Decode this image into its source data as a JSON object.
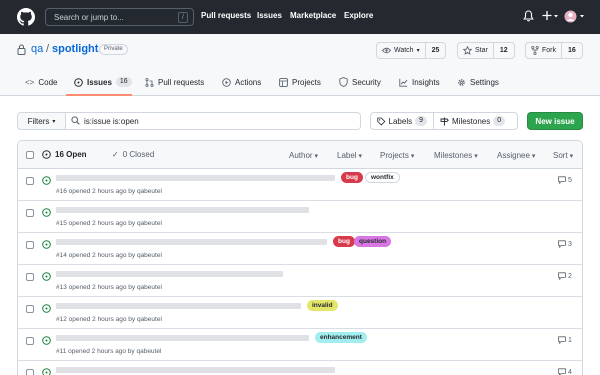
{
  "header": {
    "search_placeholder": "Search or jump to...",
    "search_shortcut": "/",
    "nav": [
      "Pull requests",
      "Issues",
      "Marketplace",
      "Explore"
    ]
  },
  "repo": {
    "owner": "qa",
    "separator": "/",
    "name": "spotlight",
    "visibility": "Private",
    "watch": {
      "label": "Watch",
      "count": "25"
    },
    "star": {
      "label": "Star",
      "count": "12"
    },
    "fork": {
      "label": "Fork",
      "count": "16"
    }
  },
  "tabs": [
    {
      "label": "Code"
    },
    {
      "label": "Issues",
      "count": "16"
    },
    {
      "label": "Pull requests"
    },
    {
      "label": "Actions"
    },
    {
      "label": "Projects"
    },
    {
      "label": "Security"
    },
    {
      "label": "Insights"
    },
    {
      "label": "Settings"
    }
  ],
  "toolbar": {
    "filters_label": "Filters",
    "query": "is:issue is:open",
    "labels": {
      "label": "Labels",
      "count": "9"
    },
    "milestones": {
      "label": "Milestones",
      "count": "0"
    },
    "new_issue": "New issue"
  },
  "list_header": {
    "open": "16 Open",
    "closed": "0 Closed",
    "filters": [
      "Author",
      "Label",
      "Projects",
      "Milestones",
      "Assignee",
      "Sort"
    ]
  },
  "issues": [
    {
      "meta": "#16 opened 2 hours ago by qabeutel",
      "labels": [
        {
          "name": "bug",
          "bg": "#d73a4a",
          "fg": "#ffffff"
        },
        {
          "name": "wontfix",
          "bg": "#ffffff",
          "fg": "#24292f",
          "border": "#d0d7de"
        }
      ],
      "comments": "5"
    },
    {
      "meta": "#15 opened 2 hours ago by qabeutel",
      "labels": [],
      "comments": ""
    },
    {
      "meta": "#14 opened 2 hours ago by qabeutel",
      "labels": [
        {
          "name": "bug",
          "bg": "#d73a4a",
          "fg": "#ffffff"
        },
        {
          "name": "question",
          "bg": "#d876e3",
          "fg": "#24292f"
        }
      ],
      "comments": "3"
    },
    {
      "meta": "#13 opened 2 hours ago by qabeutel",
      "labels": [],
      "comments": "2"
    },
    {
      "meta": "#12 opened 2 hours ago by qabeutel",
      "labels": [
        {
          "name": "invalid",
          "bg": "#e4e669",
          "fg": "#24292f"
        }
      ],
      "comments": ""
    },
    {
      "meta": "#11 opened 2 hours ago by qabeutel",
      "labels": [
        {
          "name": "enhancement",
          "bg": "#a2eeef",
          "fg": "#24292f"
        }
      ],
      "comments": "1"
    },
    {
      "meta": "",
      "labels": [],
      "comments": "4"
    }
  ],
  "colors": {
    "open_icon": "#1a7f37",
    "accent": "#0969da",
    "new_issue": "#2da44e",
    "tab_underline": "#fd8c73"
  }
}
